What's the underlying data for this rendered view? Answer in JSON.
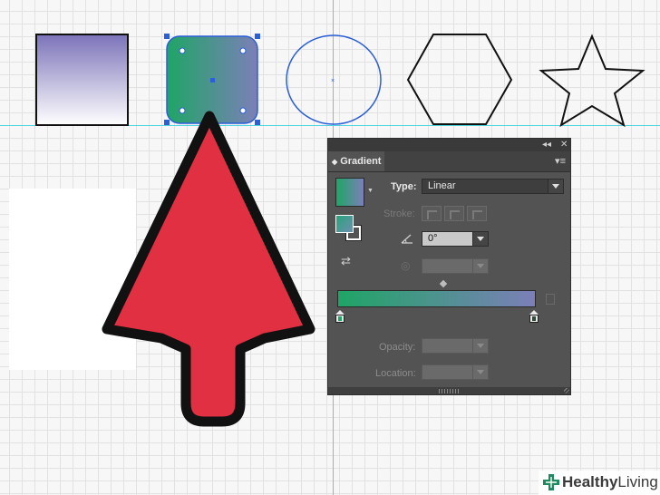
{
  "colors": {
    "gradient_start": "#1fa566",
    "gradient_end": "#7c7fb8",
    "square_gradient_start": "#7b73b9",
    "square_gradient_end": "#ffffff",
    "guide": "#4fd3df",
    "selection": "#2b5fd9",
    "arrow_fill": "#e03042",
    "arrow_outline": "#111111",
    "panel_bg": "#535353"
  },
  "canvas": {
    "shapes": [
      {
        "type": "square",
        "fill": "purple-to-white gradient"
      },
      {
        "type": "rounded-square",
        "fill": "green-to-purple gradient",
        "selected": true
      },
      {
        "type": "circle",
        "fill": "none",
        "selected": true
      },
      {
        "type": "hexagon",
        "fill": "none"
      },
      {
        "type": "star",
        "fill": "none"
      }
    ],
    "pointer_icon": "arrow-up-icon"
  },
  "panel": {
    "title": "Gradient",
    "collapse_icon": "double-chevron-icon",
    "close_icon": "close-icon",
    "menu_icon": "panel-menu-icon",
    "type_label": "Type:",
    "type_value": "Linear",
    "stroke_label": "Stroke:",
    "angle_value": "0°",
    "aspect_value": "",
    "opacity_label": "Opacity:",
    "opacity_value": "",
    "location_label": "Location:",
    "location_value": ""
  },
  "watermark": {
    "brand_bold": "Healthy",
    "brand_regular": "Living"
  }
}
